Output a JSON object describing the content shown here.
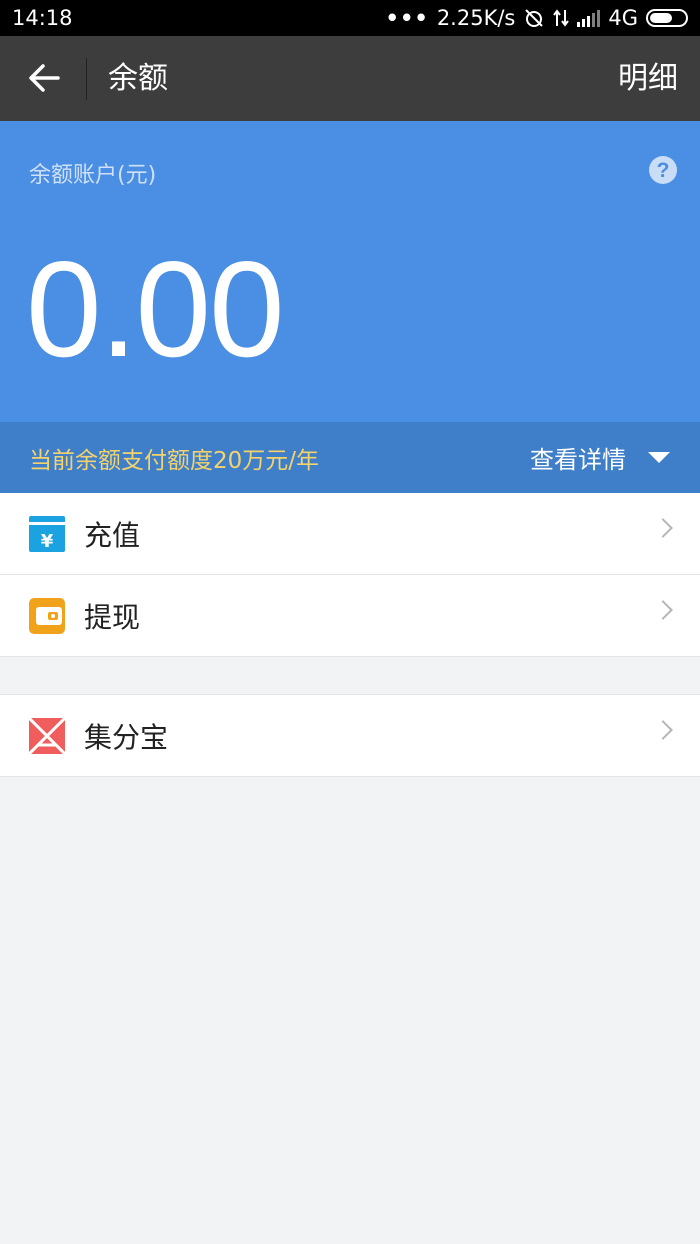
{
  "status_bar": {
    "time": "14:18",
    "dots": "•••",
    "speed": "2.25K/s",
    "network": "4G"
  },
  "header": {
    "title": "余额",
    "detail_label": "明细"
  },
  "balance": {
    "label": "余额账户(元)",
    "amount": "0.00",
    "quota_text": "当前余额支付额度20万元/年",
    "view_detail_label": "查看详情"
  },
  "menu": {
    "recharge": {
      "label": "充值",
      "icon": "yuan-wallet-icon",
      "color": "#1aa3e0"
    },
    "withdraw": {
      "label": "提现",
      "icon": "wallet-icon",
      "color": "#f0a21b"
    },
    "jifenbao": {
      "label": "集分宝",
      "icon": "jifenbao-icon",
      "color": "#ef5d5d"
    }
  }
}
